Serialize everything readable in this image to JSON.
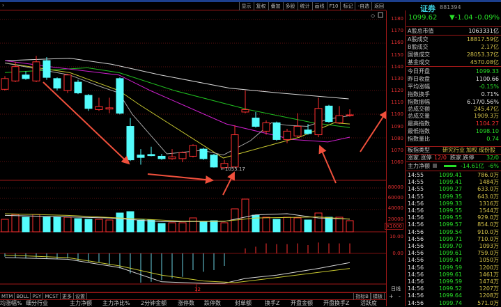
{
  "toolbar": {
    "left_icon": "chevron-right-icon",
    "buttons": [
      "显示",
      "复权",
      "叠加",
      "多股",
      "统计",
      "画线",
      "F10",
      "标记",
      "-自选",
      "返回"
    ]
  },
  "quote": {
    "name": "证券",
    "code": "881394",
    "price": "1099.62",
    "change": "▼-1.04",
    "change_pct": "-0.09%"
  },
  "stats": [
    {
      "label": "A股总市值",
      "value": "1063331亿",
      "color": "#e8e8e8"
    },
    {
      "label": "A股成交",
      "value": "18817.59亿",
      "color": "#d4c24a"
    },
    {
      "label": "B股成交",
      "value": "2.17亿",
      "color": "#d4c24a"
    },
    {
      "label": "国债成交",
      "value": "28053.37亿",
      "color": "#d4c24a"
    },
    {
      "label": "基金成交",
      "value": "4570.08亿",
      "color": "#d4c24a"
    },
    {
      "label": "今日开盘",
      "value": "1099.33",
      "color": "#28e028"
    },
    {
      "label": "昨日收盘",
      "value": "1100.66",
      "color": "#e8e8e8"
    },
    {
      "label": "平均涨幅",
      "value": "-0.15%",
      "color": "#28e028"
    },
    {
      "label": "指数换手",
      "value": "0.71%",
      "color": "#e8e8e8"
    },
    {
      "label": "指数振幅",
      "value": "6.17/0.56%",
      "color": "#e8e8e8"
    },
    {
      "label": "总成交额",
      "value": "245.47亿",
      "color": "#d4c24a"
    },
    {
      "label": "总成交量",
      "value": "1909.3万",
      "color": "#d4c24a"
    },
    {
      "label": "最高指数",
      "value": "1104.27",
      "color": "#ff3030"
    },
    {
      "label": "最低指数",
      "value": "1098.10",
      "color": "#28e028"
    },
    {
      "label": "指数量比",
      "value": "0.74",
      "color": "#28e028"
    }
  ],
  "board": {
    "label": "板指类型",
    "type": "研究行业",
    "weight": "加权",
    "constituents": "成份股"
  },
  "limits": {
    "up_label": "涨家.涨停",
    "up_value": "12/0",
    "down_label": "跌家.跌停",
    "down_value": "32/0"
  },
  "main_flow": {
    "label": "主力净额",
    "value": "-14.61亿",
    "pct": "-6%"
  },
  "ticks": [
    [
      "14:55",
      "1099.41",
      "786.0万"
    ],
    [
      "14:55",
      "1099.41",
      "1484万"
    ],
    [
      "14:55",
      "1099.27",
      "633.0万"
    ],
    [
      "14:55",
      "1099.35",
      "643.0万"
    ],
    [
      "14:56",
      "1099.33",
      "1316万"
    ],
    [
      "14:56",
      "1099.55",
      "1544万"
    ],
    [
      "14:56",
      "1099.55",
      "929.0万"
    ],
    [
      "14:56",
      "1099.57",
      "854.0万"
    ],
    [
      "14:56",
      "1099.54",
      "910.0万"
    ],
    [
      "14:56",
      "1099.71",
      "710.0万"
    ],
    [
      "14:56",
      "1099.70",
      "1093万"
    ],
    [
      "14:56",
      "1099.61",
      "759.0万"
    ],
    [
      "14:56",
      "1099.47",
      "1050万"
    ],
    [
      "14:56",
      "1099.59",
      "1200万"
    ],
    [
      "14:56",
      "1099.61",
      "1461万"
    ],
    [
      "14:56",
      "1099.59",
      "1474万"
    ],
    [
      "14:56",
      "1099.52",
      "1207万"
    ],
    [
      "14:56",
      "1099.64",
      "1208万"
    ],
    [
      "14:56",
      "1099.74",
      "571.0万"
    ]
  ],
  "axis": {
    "price_ticks": [
      1180,
      1170,
      1160,
      1150,
      1140,
      1130,
      1120,
      1110,
      1100,
      1090,
      1080,
      1070,
      1060
    ],
    "volume_ticks": [
      "80000",
      "60000",
      "40000",
      "20000"
    ],
    "volume_unit": "X1000",
    "macd_ticks": [
      "10.00",
      "0.00"
    ],
    "x_label": "12",
    "period": "日线",
    "zoom_in": "+",
    "zoom_out": "-"
  },
  "low_marker": "←1055.17",
  "indicator_tabs": [
    "MTM",
    "BOLL",
    "PSY",
    "MCST",
    "更多",
    "设置"
  ],
  "indicator_right": [
    "指标B",
    "模板"
  ],
  "columns": [
    "均涨幅%",
    "细分行业",
    "主力净额",
    "主力净比%",
    "2分钟金额",
    "涨停数",
    "跌停数",
    "封单额",
    "换手Z",
    "开盘金额",
    "开盘换手Z",
    "活跃度"
  ],
  "colors": {
    "up": "#ff3030",
    "down": "#54fcfc",
    "grid": "#a01818",
    "arrow": "#f0503c"
  },
  "chart_data": {
    "type": "candlestick",
    "ylim": [
      1052,
      1186
    ],
    "ohlc": [
      [
        1121,
        1132,
        1120,
        1130
      ],
      [
        1128,
        1144,
        1127,
        1140
      ],
      [
        1133,
        1136,
        1129,
        1130
      ],
      [
        1128,
        1149,
        1127,
        1144
      ],
      [
        1145,
        1148,
        1129,
        1131
      ],
      [
        1130,
        1131,
        1120,
        1122
      ],
      [
        1120,
        1134,
        1118,
        1133
      ],
      [
        1127,
        1129,
        1117,
        1118
      ],
      [
        1116,
        1117,
        1103,
        1105
      ],
      [
        1104,
        1114,
        1103,
        1106.6
      ],
      [
        1104.5,
        1114,
        1101,
        1105.5
      ],
      [
        1130,
        1131,
        1100,
        1101
      ],
      [
        1090,
        1097,
        1061,
        1062
      ],
      [
        1066,
        1071,
        1058,
        1064
      ],
      [
        1066.5,
        1073,
        1065,
        1065.5
      ],
      [
        1065,
        1067,
        1062,
        1063
      ],
      [
        1063,
        1071,
        1062,
        1064.5
      ],
      [
        1063,
        1069,
        1060,
        1068
      ],
      [
        1065,
        1075,
        1064,
        1074
      ],
      [
        1071,
        1072,
        1062,
        1063
      ],
      [
        1066,
        1067,
        1055.5,
        1056
      ],
      [
        1055.5,
        1062,
        1055.17,
        1059
      ],
      [
        1056,
        1091,
        1055.5,
        1083
      ],
      [
        1102,
        1120,
        1101,
        1104
      ],
      [
        1097,
        1102,
        1089,
        1090
      ],
      [
        1086,
        1095,
        1083,
        1093
      ],
      [
        1093,
        1094,
        1078,
        1079
      ],
      [
        1079,
        1088,
        1076,
        1086
      ],
      [
        1082,
        1101,
        1081,
        1090
      ],
      [
        1087,
        1092,
        1083,
        1084
      ],
      [
        1083,
        1114,
        1081,
        1105
      ],
      [
        1107,
        1108,
        1093,
        1094
      ],
      [
        1093,
        1107,
        1092,
        1099
      ],
      [
        1099.33,
        1104.27,
        1098.1,
        1099.62
      ]
    ],
    "ma_lines": [
      {
        "color": "#d8d8d8",
        "points": [
          [
            0,
            1145
          ],
          [
            6.2,
            1147
          ],
          [
            10.2,
            1142
          ],
          [
            14.9,
            1133
          ],
          [
            21.5,
            1122
          ],
          [
            26.2,
            1118
          ],
          [
            32.9,
            1113
          ]
        ]
      },
      {
        "color": "#20c020",
        "points": [
          [
            0,
            1135
          ],
          [
            7.9,
            1139
          ],
          [
            10.9,
            1135
          ],
          [
            16.2,
            1120
          ],
          [
            23.3,
            1104
          ],
          [
            29.5,
            1093
          ],
          [
            33,
            1089
          ]
        ]
      },
      {
        "color": "#d020d0",
        "points": [
          [
            0,
            1145
          ],
          [
            4.2,
            1140
          ],
          [
            10.9,
            1133
          ],
          [
            13.9,
            1120
          ],
          [
            21.2,
            1092
          ],
          [
            27.5,
            1079
          ],
          [
            30.9,
            1077
          ],
          [
            33,
            1081
          ]
        ]
      },
      {
        "color": "#c8c830",
        "points": [
          [
            0,
            1143
          ],
          [
            6.2,
            1135
          ],
          [
            10.9,
            1120
          ],
          [
            12.9,
            1108
          ],
          [
            20.9,
            1063.5
          ],
          [
            28.2,
            1081
          ],
          [
            31.5,
            1093
          ],
          [
            33,
            1092
          ]
        ]
      },
      {
        "color": "#a8a8a8",
        "points": [
          [
            0,
            1143
          ],
          [
            6.2,
            1133
          ],
          [
            8.9,
            1124
          ],
          [
            10.9,
            1118
          ],
          [
            12.2,
            1100
          ],
          [
            15.5,
            1067
          ],
          [
            18.9,
            1070
          ],
          [
            20.9,
            1066
          ],
          [
            23.5,
            1078
          ],
          [
            25.5,
            1093
          ],
          [
            26.9,
            1091
          ],
          [
            28.9,
            1090
          ],
          [
            30.9,
            1096
          ],
          [
            33,
            1099
          ]
        ]
      }
    ],
    "volume": [
      19600,
      28750,
      23500,
      28750,
      23500,
      23500,
      23500,
      20900,
      19600,
      19600,
      18300,
      31400,
      34000,
      18300,
      18300,
      11800,
      13100,
      13100,
      22200,
      14400,
      17000,
      13100,
      39200,
      57500,
      27400,
      23500,
      19600,
      23500,
      22200,
      18300,
      31400,
      23500,
      23500,
      17000
    ],
    "volume_ma": [
      {
        "color": "#d8d8d8",
        "points": [
          [
            0,
            27000
          ],
          [
            10,
            22000
          ],
          [
            15,
            15000
          ],
          [
            21,
            15500
          ],
          [
            24,
            28000
          ],
          [
            27,
            30000
          ],
          [
            30,
            22000
          ],
          [
            33,
            20000
          ]
        ]
      },
      {
        "color": "#c8c830",
        "points": [
          [
            0,
            30000
          ],
          [
            6,
            27000
          ],
          [
            12,
            21000
          ],
          [
            17,
            16000
          ],
          [
            21,
            16000
          ],
          [
            24,
            22000
          ],
          [
            30,
            24000
          ],
          [
            33,
            20000
          ]
        ]
      }
    ],
    "macd": [
      -2,
      -2.5,
      -3,
      -2.5,
      -3,
      -3.5,
      -3,
      -4.5,
      -5,
      -5.5,
      -7,
      -9,
      -12,
      -17.5,
      -17,
      -16,
      -15,
      -14,
      -10,
      -11,
      -10,
      -7.5,
      0,
      3,
      4,
      6,
      5.5,
      5.5,
      6,
      5,
      6.5,
      6,
      6,
      6
    ],
    "dif": [
      [
        0,
        -2.5
      ],
      [
        6,
        -3.5
      ],
      [
        11,
        -8.5
      ],
      [
        15,
        -17
      ],
      [
        19,
        -19
      ],
      [
        21,
        -18
      ],
      [
        23,
        -15
      ],
      [
        26,
        -13
      ],
      [
        30,
        -9
      ],
      [
        33,
        -5.5
      ]
    ],
    "dea": [
      [
        0,
        -1
      ],
      [
        6,
        -2.5
      ],
      [
        11,
        -7.5
      ],
      [
        15,
        -13
      ],
      [
        19,
        -16.5
      ],
      [
        22,
        -17.5
      ],
      [
        26,
        -14.5
      ],
      [
        33,
        -9
      ]
    ]
  }
}
